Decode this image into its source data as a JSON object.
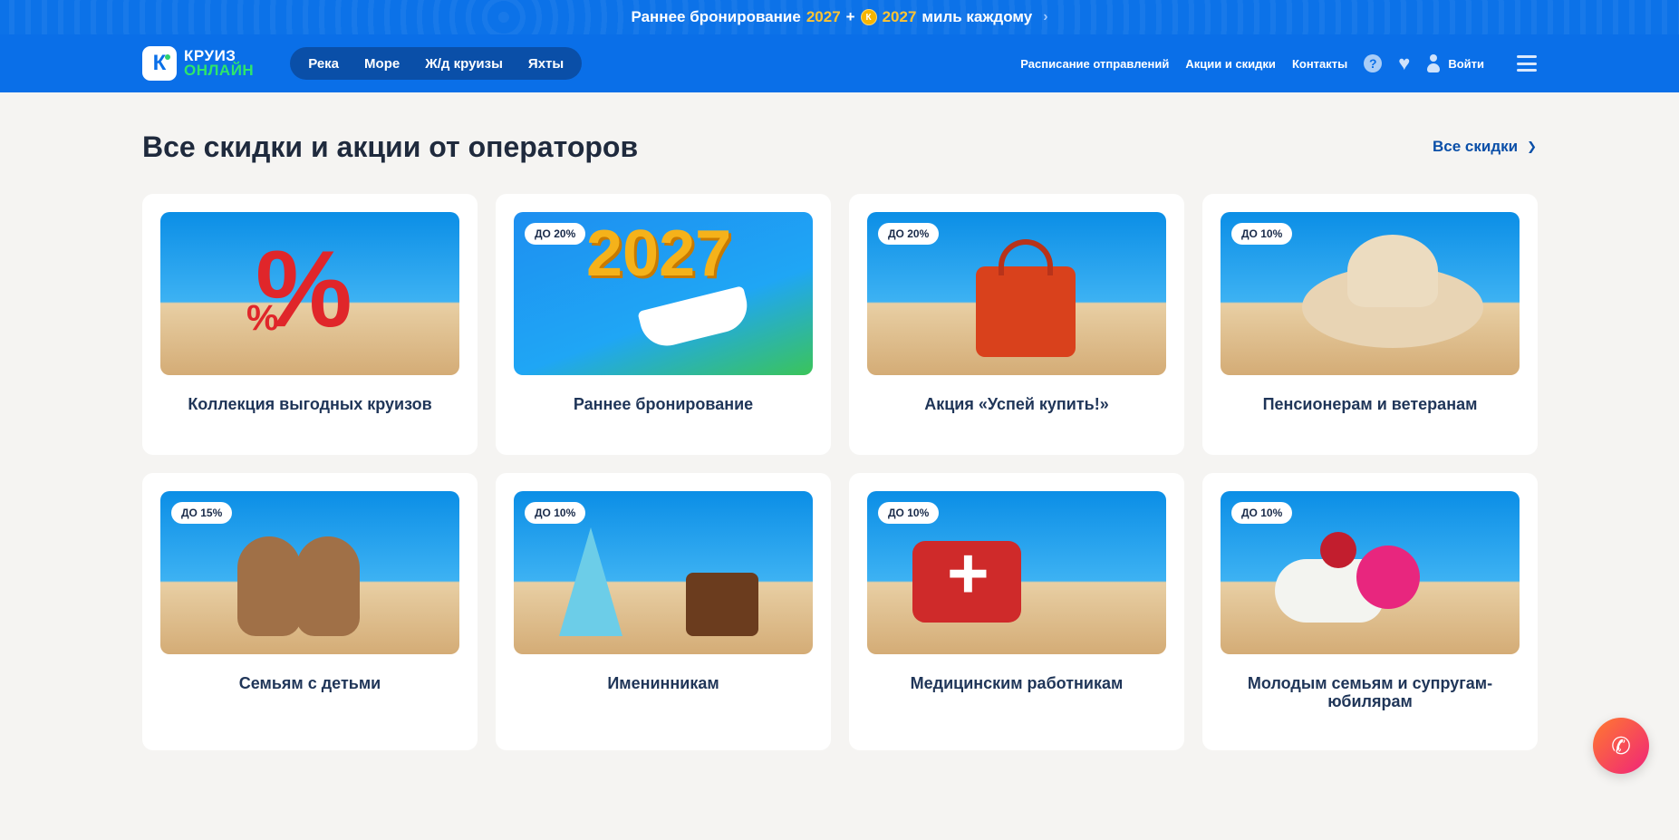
{
  "promo": {
    "text_before": "Раннее бронирование",
    "year_accent": "2027",
    "plus": "+",
    "coin_letter": "К",
    "miles_accent": "2027",
    "text_after": "миль каждому",
    "chevron": "›"
  },
  "header": {
    "logo": {
      "mark": "К",
      "line1": "КРУИЗ",
      "line2": "ОНЛАЙН"
    },
    "nav": [
      {
        "label": "Река"
      },
      {
        "label": "Море"
      },
      {
        "label": "Ж/д круизы"
      },
      {
        "label": "Яхты"
      }
    ],
    "links": [
      {
        "label": "Расписание отправлений"
      },
      {
        "label": "Акции и скидки"
      },
      {
        "label": "Контакты"
      }
    ],
    "help_glyph": "?",
    "heart_glyph": "♥",
    "login_label": "Войти",
    "icons": [
      "help-icon",
      "heart-icon",
      "user-icon",
      "burger-menu-icon"
    ]
  },
  "section": {
    "title": "Все скидки и акции от операторов",
    "all_link": "Все скидки",
    "all_link_chevron": "❯"
  },
  "cards": [
    {
      "title": "Коллекция выгодных круизов",
      "badge": "",
      "scene": "percent-sign"
    },
    {
      "title": "Раннее бронирование",
      "badge": "ДО 20%",
      "scene": "2027-cruise-ship"
    },
    {
      "title": "Акция «Успей купить!»",
      "badge": "ДО 20%",
      "scene": "red-bag-clock"
    },
    {
      "title": "Пенсионерам и ветеранам",
      "badge": "ДО 10%",
      "scene": "sun-hat"
    },
    {
      "title": "Семьям с детьми",
      "badge": "ДО 15%",
      "scene": "teddy-bears"
    },
    {
      "title": "Именинникам",
      "badge": "ДО 10%",
      "scene": "party-cake"
    },
    {
      "title": "Медицинским работникам",
      "badge": "ДО 10%",
      "scene": "first-aid-kit"
    },
    {
      "title": "Молодым семьям и супругам-юбилярам",
      "badge": "ДО 10%",
      "scene": "wedding-rings-flowers"
    }
  ],
  "decor": {
    "percent": "%",
    "year": "2027"
  },
  "call_button": {
    "glyph": "✆"
  },
  "colors": {
    "header_blue": "#0a6fe8",
    "nav_pill": "#0a4fa8",
    "promo_accent": "#ffc432",
    "logo_green": "#2ee66a",
    "page_bg": "#f5f4f2",
    "call_gradient_start": "#ff7a2f",
    "call_gradient_end": "#f0237a"
  }
}
